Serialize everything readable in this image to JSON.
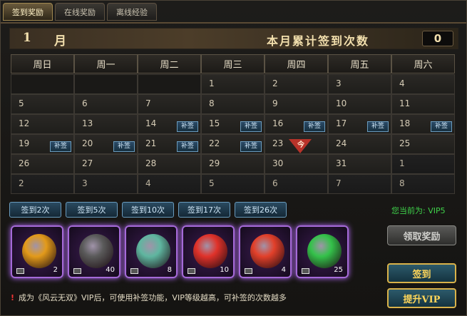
{
  "tabs": [
    "签到奖励",
    "在线奖励",
    "离线经验"
  ],
  "header": {
    "month_num": "1",
    "month_label": "月",
    "count_label": "本月累计签到次数",
    "count_value": "0"
  },
  "weekdays": [
    "周日",
    "周一",
    "周二",
    "周三",
    "周四",
    "周五",
    "周六"
  ],
  "makeup_label": "补签",
  "today_label": "今",
  "weeks": [
    [
      {
        "d": ""
      },
      {
        "d": ""
      },
      {
        "d": ""
      },
      {
        "d": "1"
      },
      {
        "d": "2"
      },
      {
        "d": "3"
      },
      {
        "d": "4"
      }
    ],
    [
      {
        "d": "5"
      },
      {
        "d": "6"
      },
      {
        "d": "7"
      },
      {
        "d": "8"
      },
      {
        "d": "9"
      },
      {
        "d": "10"
      },
      {
        "d": "11"
      }
    ],
    [
      {
        "d": "12"
      },
      {
        "d": "13"
      },
      {
        "d": "14",
        "m": true
      },
      {
        "d": "15",
        "m": true
      },
      {
        "d": "16",
        "m": true
      },
      {
        "d": "17",
        "m": true
      },
      {
        "d": "18",
        "m": true
      }
    ],
    [
      {
        "d": "19",
        "m": true
      },
      {
        "d": "20",
        "m": true
      },
      {
        "d": "21",
        "m": true
      },
      {
        "d": "22",
        "m": true
      },
      {
        "d": "23",
        "today": true
      },
      {
        "d": "24"
      },
      {
        "d": "25"
      }
    ],
    [
      {
        "d": "26"
      },
      {
        "d": "27"
      },
      {
        "d": "28"
      },
      {
        "d": "29"
      },
      {
        "d": "30"
      },
      {
        "d": "31"
      },
      {
        "d": "1",
        "o": true
      }
    ],
    [
      {
        "d": "2",
        "o": true
      },
      {
        "d": "3",
        "o": true
      },
      {
        "d": "4",
        "o": true
      },
      {
        "d": "5",
        "o": true
      },
      {
        "d": "6",
        "o": true
      },
      {
        "d": "7",
        "o": true
      },
      {
        "d": "8",
        "o": true
      }
    ]
  ],
  "milestones": [
    "签到2次",
    "签到5次",
    "签到10次",
    "签到17次",
    "签到26次"
  ],
  "vip_label": "您当前为: VIP5",
  "rewards": [
    {
      "count": "2",
      "icon": "orange-orb-icon",
      "color": "#e39a1a"
    },
    {
      "count": "40",
      "icon": "dark-armor-icon",
      "color": "#5a5a5a"
    },
    {
      "count": "8",
      "icon": "jade-talisman-icon",
      "color": "#5fb6a0"
    },
    {
      "count": "10",
      "icon": "red-crystal-icon",
      "color": "#e0322a"
    },
    {
      "count": "4",
      "icon": "fire-orb-icon",
      "color": "#e2402a"
    },
    {
      "count": "25",
      "icon": "green-orb-icon",
      "color": "#34c24a"
    }
  ],
  "buttons": {
    "claim": "领取奖励",
    "sign": "签到",
    "vip": "提升VIP"
  },
  "footer": {
    "mark": "!",
    "text": "成为《风云无双》VIP后，可使用补签功能，VIP等级越高，可补签的次数越多"
  }
}
